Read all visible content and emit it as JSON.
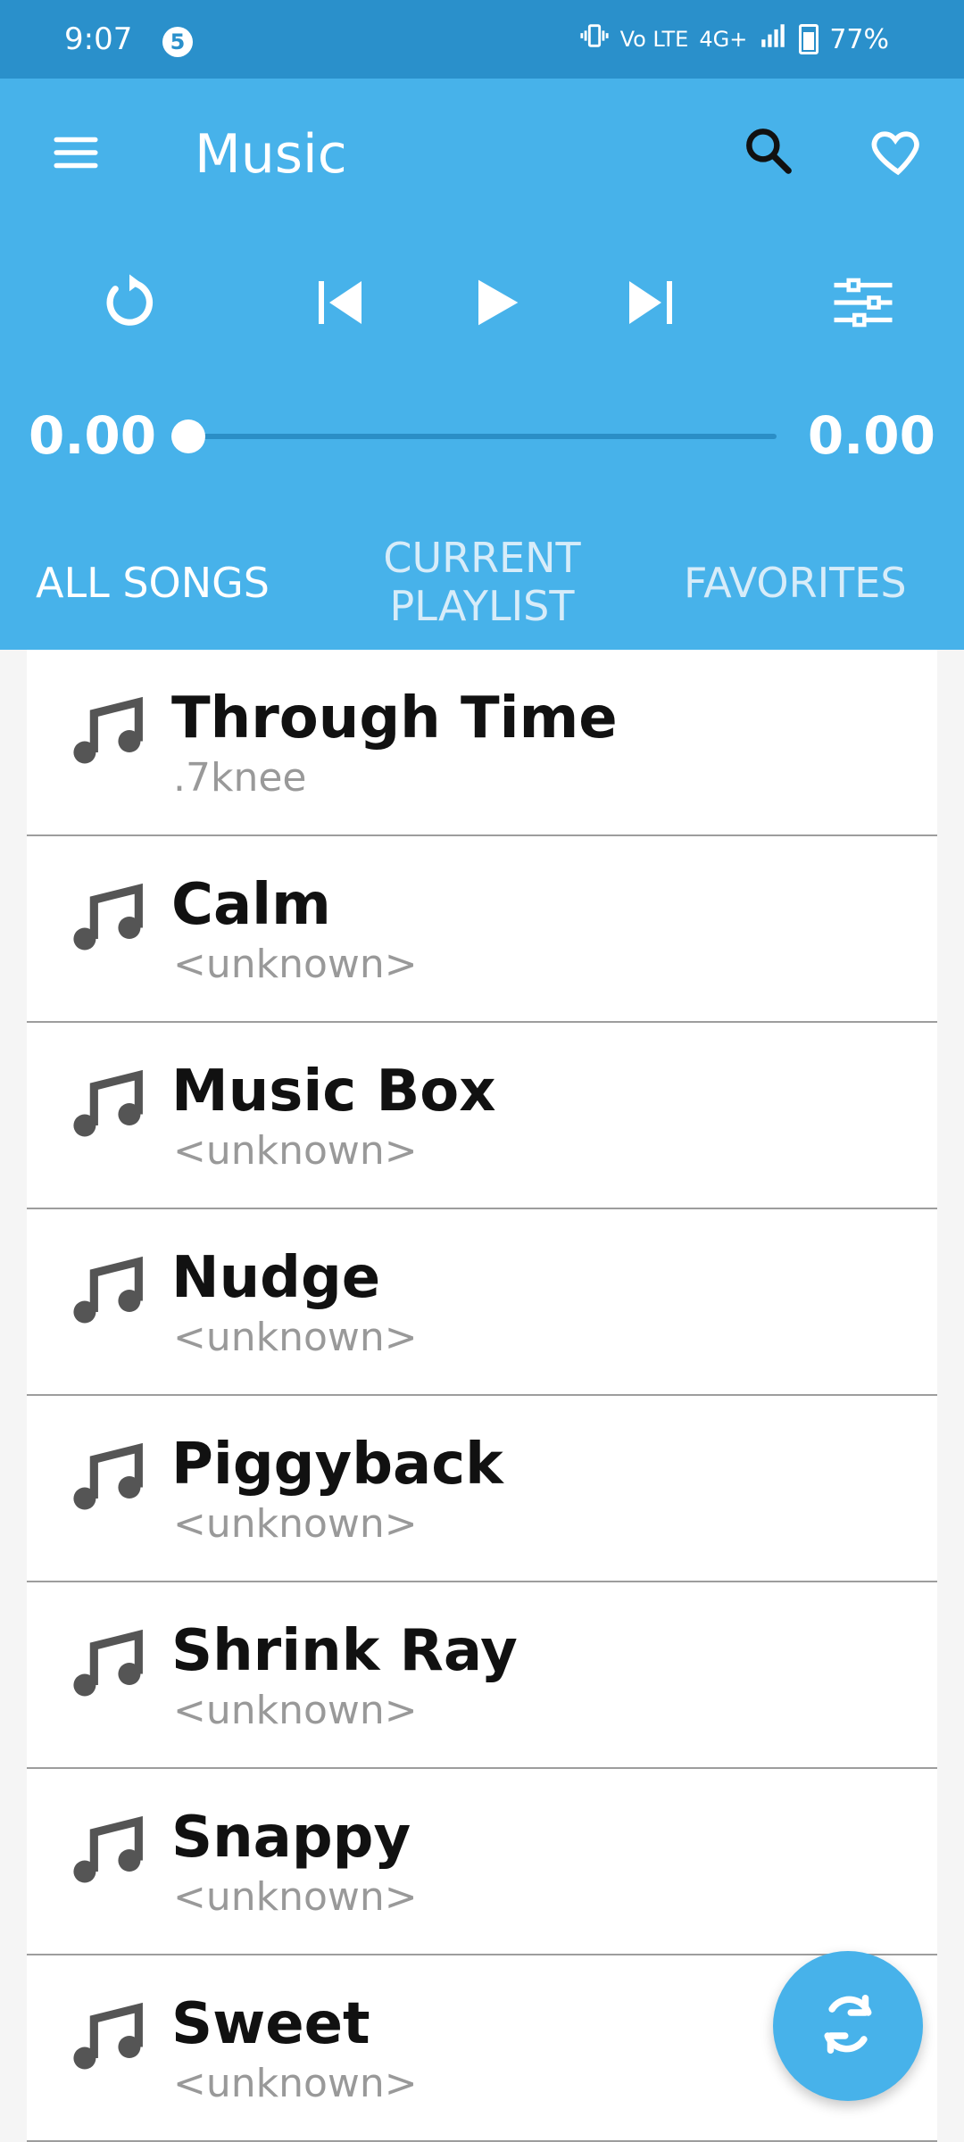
{
  "status": {
    "time": "9:07",
    "notification_count": "5",
    "network": "4G+",
    "battery": "77%",
    "icons": [
      "vibrate-icon",
      "volte-icon",
      "signal-icon",
      "battery-icon"
    ]
  },
  "header": {
    "title": "Music",
    "icons": [
      "menu-icon",
      "search-icon",
      "heart-icon"
    ]
  },
  "player": {
    "current_time": "0.00",
    "total_time": "0.00",
    "progress": 0,
    "controls": [
      "replay-icon",
      "previous-icon",
      "play-icon",
      "next-icon",
      "equalizer-icon"
    ]
  },
  "tabs": [
    {
      "label": "ALL SONGS",
      "active": true
    },
    {
      "label": "CURRENT PLAYLIST",
      "active": false
    },
    {
      "label": "FAVORITES",
      "active": false
    }
  ],
  "songs": [
    {
      "title": "Through Time",
      "artist": ".7knee"
    },
    {
      "title": "Calm",
      "artist": "<unknown>"
    },
    {
      "title": "Music Box",
      "artist": "<unknown>"
    },
    {
      "title": "Nudge",
      "artist": "<unknown>"
    },
    {
      "title": "Piggyback",
      "artist": "<unknown>"
    },
    {
      "title": "Shrink Ray",
      "artist": "<unknown>"
    },
    {
      "title": "Snappy",
      "artist": "<unknown>"
    },
    {
      "title": "Sweet",
      "artist": "<unknown>"
    }
  ],
  "fab": {
    "icon": "sync-icon"
  },
  "colors": {
    "status_bar": "#2a90cb",
    "header": "#47b2ea",
    "accent": "#47b2ea",
    "tab_inactive": "#d7ecf9",
    "artist_text": "#999999"
  }
}
